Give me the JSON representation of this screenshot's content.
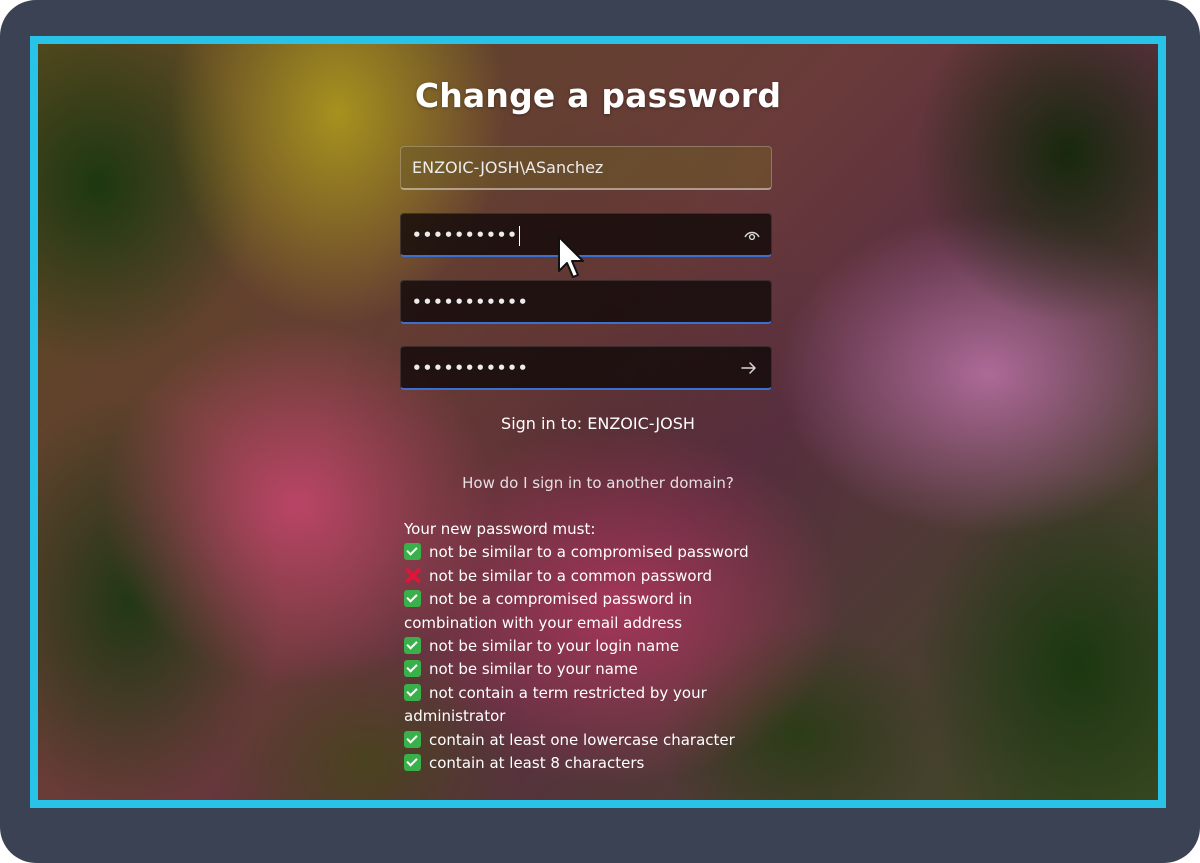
{
  "title": "Change a password",
  "username_field": {
    "value": "ENZOIC-JOSH\\ASanchez"
  },
  "old_password_field": {
    "value": "••••••••••",
    "reveal_icon": "eye-icon"
  },
  "new_password_field": {
    "value": "•••••••••••"
  },
  "confirm_password_field": {
    "value": "•••••••••••",
    "submit_icon": "arrow-right-icon"
  },
  "sign_in_to": "Sign in to: ENZOIC-JOSH",
  "other_domain_link": "How do I sign in to another domain?",
  "requirements": {
    "heading": "Your new password must:",
    "items": [
      {
        "status": "pass",
        "text": "not be similar to a compromised password"
      },
      {
        "status": "fail",
        "text": "not be similar to a common password"
      },
      {
        "status": "pass",
        "text": "not be a compromised password in combination with your email address"
      },
      {
        "status": "pass",
        "text": "not be similar to your login name"
      },
      {
        "status": "pass",
        "text": "not be similar to your name"
      },
      {
        "status": "pass",
        "text": "not contain a term restricted by your administrator"
      },
      {
        "status": "pass",
        "text": "contain at least one lowercase character"
      },
      {
        "status": "pass",
        "text": "contain at least 8 characters"
      }
    ]
  },
  "colors": {
    "frame": "#3b4254",
    "highlight_border": "#28c3e6",
    "pass": "#3ab04a",
    "fail": "#e0153a",
    "focus_underline": "#3b6fd0"
  }
}
